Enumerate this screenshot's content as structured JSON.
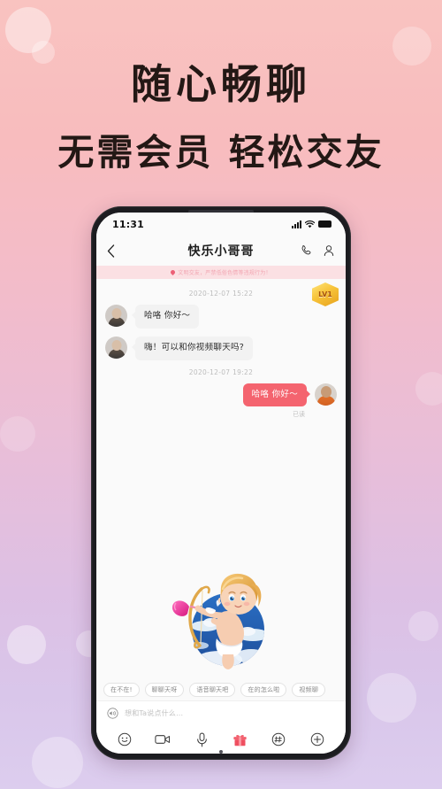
{
  "promo": {
    "headline": "随心畅聊",
    "subhead": "无需会员  轻松交友"
  },
  "colors": {
    "bg_top": "#f9c3c0",
    "bg_bottom": "#dccdee",
    "accent": "#f4646f",
    "notice_bg": "#fbe0e3",
    "badge_gold": "#f7c33a"
  },
  "phone": {
    "status_bar": {
      "time": "11:31",
      "signal_icon": "signal-bars-icon",
      "wifi_icon": "wifi-icon",
      "battery_icon": "battery-icon"
    },
    "nav": {
      "back_icon": "chevron-left-icon",
      "title": "快乐小哥哥",
      "call_icon": "phone-icon",
      "profile_icon": "person-icon"
    },
    "notice": {
      "heart_icon": "heart-icon",
      "text": "文明交友，严禁低俗色情等违规行为！"
    },
    "level_badge": "LV1",
    "messages": [
      {
        "kind": "timestamp",
        "text": "2020-12-07 15:22"
      },
      {
        "kind": "in",
        "text": "哈咯 你好～",
        "avatar": "avatar-female"
      },
      {
        "kind": "in",
        "text": "嗨！可以和你视频聊天吗?",
        "avatar": "avatar-female"
      },
      {
        "kind": "timestamp",
        "text": "2020-12-07 19:22"
      },
      {
        "kind": "out",
        "text": "哈咯 你好～",
        "avatar": "avatar-male",
        "status": "已读"
      }
    ],
    "read_receipt": "已读",
    "quick_replies": [
      "在不在!",
      "聊聊天呀",
      "语音聊天吧",
      "在的怎么啦",
      "视频聊"
    ],
    "input": {
      "voice_icon": "voice-wave-icon",
      "placeholder": "想和Ta说点什么..."
    },
    "toolbar": [
      {
        "icon": "smiley-icon",
        "label": "表情"
      },
      {
        "icon": "video-camera-icon",
        "label": "视频"
      },
      {
        "icon": "microphone-icon",
        "label": "语音"
      },
      {
        "icon": "gift-icon",
        "label": "礼物"
      },
      {
        "icon": "hash-circle-icon",
        "label": "话题"
      },
      {
        "icon": "plus-circle-icon",
        "label": "更多"
      }
    ],
    "illustration": "cupid-with-bow-and-heart-arrow"
  }
}
